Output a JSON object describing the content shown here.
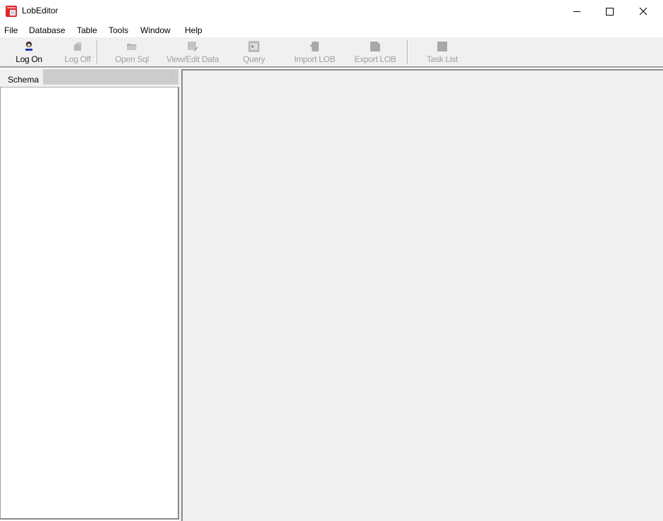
{
  "window": {
    "title": "LobEditor",
    "controls": {
      "minimize": "minimize",
      "maximize": "maximize",
      "close": "close"
    }
  },
  "menubar": {
    "items": [
      {
        "label": "File"
      },
      {
        "label": "Database"
      },
      {
        "label": "Table"
      },
      {
        "label": "Tools"
      },
      {
        "label": "Window"
      },
      {
        "label": "Help"
      }
    ]
  },
  "toolbar": {
    "buttons": [
      {
        "label": "Log On",
        "icon": "user-icon",
        "enabled": true
      },
      {
        "label": "Log Off",
        "icon": "logoff-icon",
        "enabled": false
      },
      {
        "label": "Open Sql",
        "icon": "folder-open-icon",
        "enabled": false
      },
      {
        "label": "View/Edit Data",
        "icon": "edit-table-icon",
        "enabled": false
      },
      {
        "label": "Query",
        "icon": "query-icon",
        "enabled": false
      },
      {
        "label": "Import LOB",
        "icon": "import-icon",
        "enabled": false
      },
      {
        "label": "Export LOB",
        "icon": "export-icon",
        "enabled": false
      },
      {
        "label": "Task List",
        "icon": "task-list-icon",
        "enabled": false
      }
    ]
  },
  "schema": {
    "label": "Schema",
    "selected": ""
  },
  "colors": {
    "app_icon": "#e0282a",
    "chrome": "#f0f0f0",
    "disabled_text": "#a0a0a0"
  }
}
